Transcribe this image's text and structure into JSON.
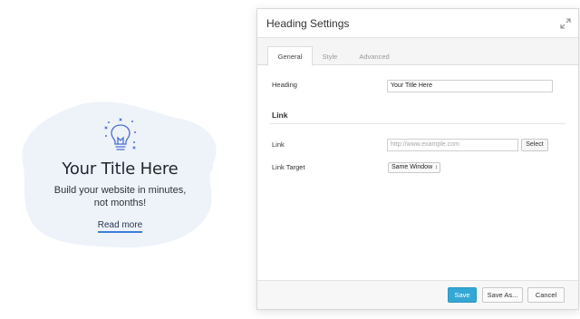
{
  "preview": {
    "title": "Your Title Here",
    "body_line1": "Build your website in minutes,",
    "body_line2": "not months!",
    "link": "Read more"
  },
  "dialog": {
    "title": "Heading Settings",
    "tabs": [
      {
        "label": "General",
        "active": true
      },
      {
        "label": "Style",
        "active": false
      },
      {
        "label": "Advanced",
        "active": false
      }
    ],
    "heading_label": "Heading",
    "heading_value": "Your Title Here",
    "section_link": "Link",
    "link_label": "Link",
    "link_placeholder": "http://www.example.com",
    "select_label": "Select",
    "link_target_label": "Link Target",
    "link_target_value": "Same Window",
    "save_label": "Save",
    "save_as_label": "Save As...",
    "cancel_label": "Cancel"
  },
  "colors": {
    "accent": "#35a7d4",
    "link_underline": "#3e7ed8",
    "blob": "#eef3fa"
  }
}
